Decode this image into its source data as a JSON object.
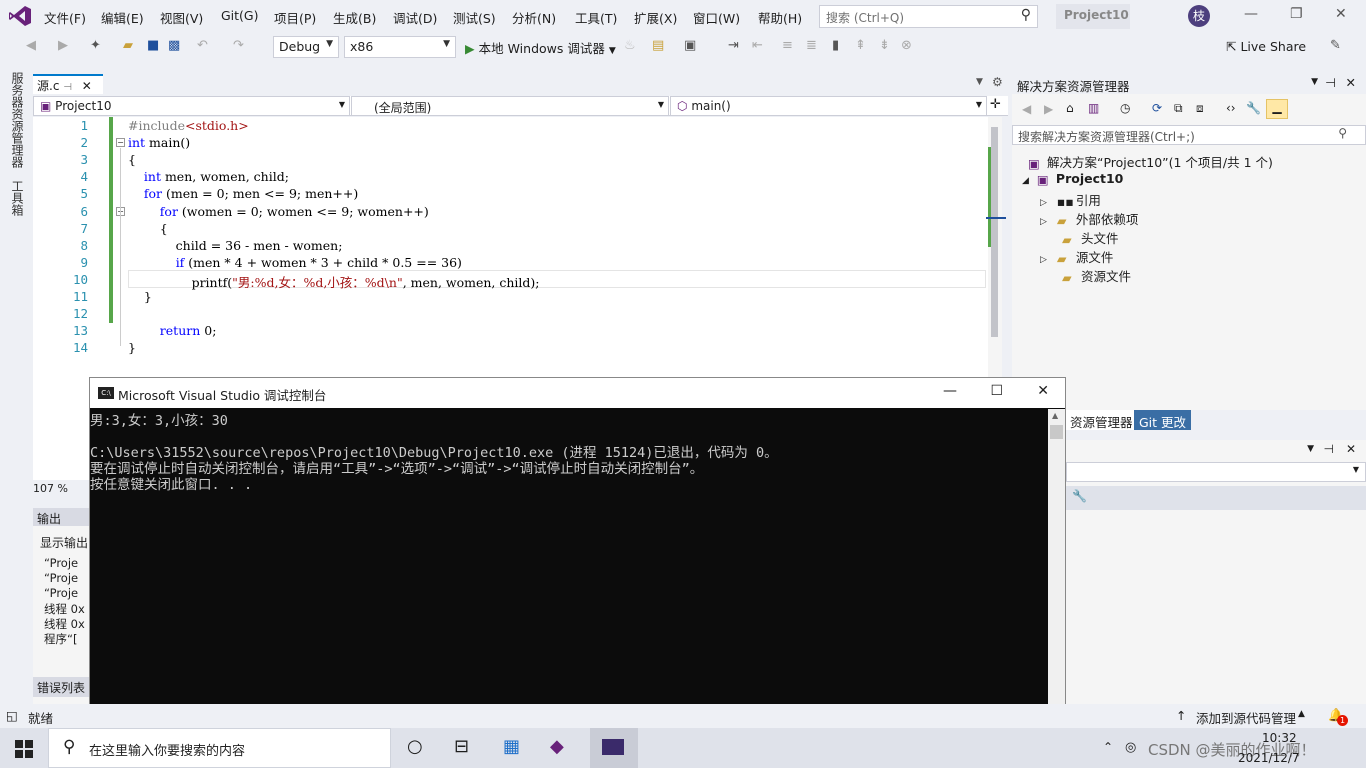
{
  "menubar": {
    "items": [
      "文件(F)",
      "编辑(E)",
      "视图(V)",
      "Git(G)",
      "项目(P)",
      "生成(B)",
      "调试(D)",
      "测试(S)",
      "分析(N)",
      "工具(T)",
      "扩展(X)",
      "窗口(W)",
      "帮助(H)"
    ],
    "search_placeholder": "搜索 (Ctrl+Q)",
    "project_badge": "Project10",
    "avatar_letter": "枝"
  },
  "toolbar": {
    "config": "Debug",
    "platform": "x86",
    "run_label": "本地 Windows 调试器",
    "live_share": "Live Share"
  },
  "left_strip": {
    "server_explorer": "服务器资源管理器",
    "toolbox": "工具箱"
  },
  "editor": {
    "tab": "源.c",
    "nav_project": "Project10",
    "nav_scope": "(全局范围)",
    "nav_function": "main()",
    "zoom": "107 %",
    "line_numbers": [
      "1",
      "2",
      "3",
      "4",
      "5",
      "6",
      "7",
      "8",
      "9",
      "10",
      "11",
      "12",
      "13",
      "14"
    ]
  },
  "output": {
    "title": "输出",
    "show_label": "显示输出",
    "lines": [
      "“Proje",
      "“Proje",
      "“Proje",
      "线程 0x",
      "线程 0x",
      "程序“["
    ],
    "error_list": "错误列表"
  },
  "solution_explorer": {
    "title": "解决方案资源管理器",
    "search_placeholder": "搜索解决方案资源管理器(Ctrl+;)",
    "solution": "解决方案“Project10”(1 个项目/共 1 个)",
    "project": "Project10",
    "items": [
      "引用",
      "外部依赖项",
      "头文件",
      "源文件",
      "资源文件"
    ],
    "tabs": [
      "资源管理器",
      "Git 更改"
    ]
  },
  "console": {
    "title": "Microsoft Visual Studio 调试控制台",
    "lines": [
      "男:3,女：3,小孩：30",
      "",
      "C:\\Users\\31552\\source\\repos\\Project10\\Debug\\Project10.exe (进程 15124)已退出，代码为 0。",
      "要在调试停止时自动关闭控制台，请启用“工具”->“选项”->“调试”->“调试停止时自动关闭控制台”。",
      "按任意键关闭此窗口. . ."
    ]
  },
  "status": {
    "ready": "就绪",
    "source_control": "添加到源代码管理",
    "notif_count": "1"
  },
  "taskbar": {
    "search_placeholder": "在这里输入你要搜索的内容",
    "time": "10:32",
    "date": "2021/12/7",
    "watermark": "CSDN @美丽的作业啊！"
  }
}
